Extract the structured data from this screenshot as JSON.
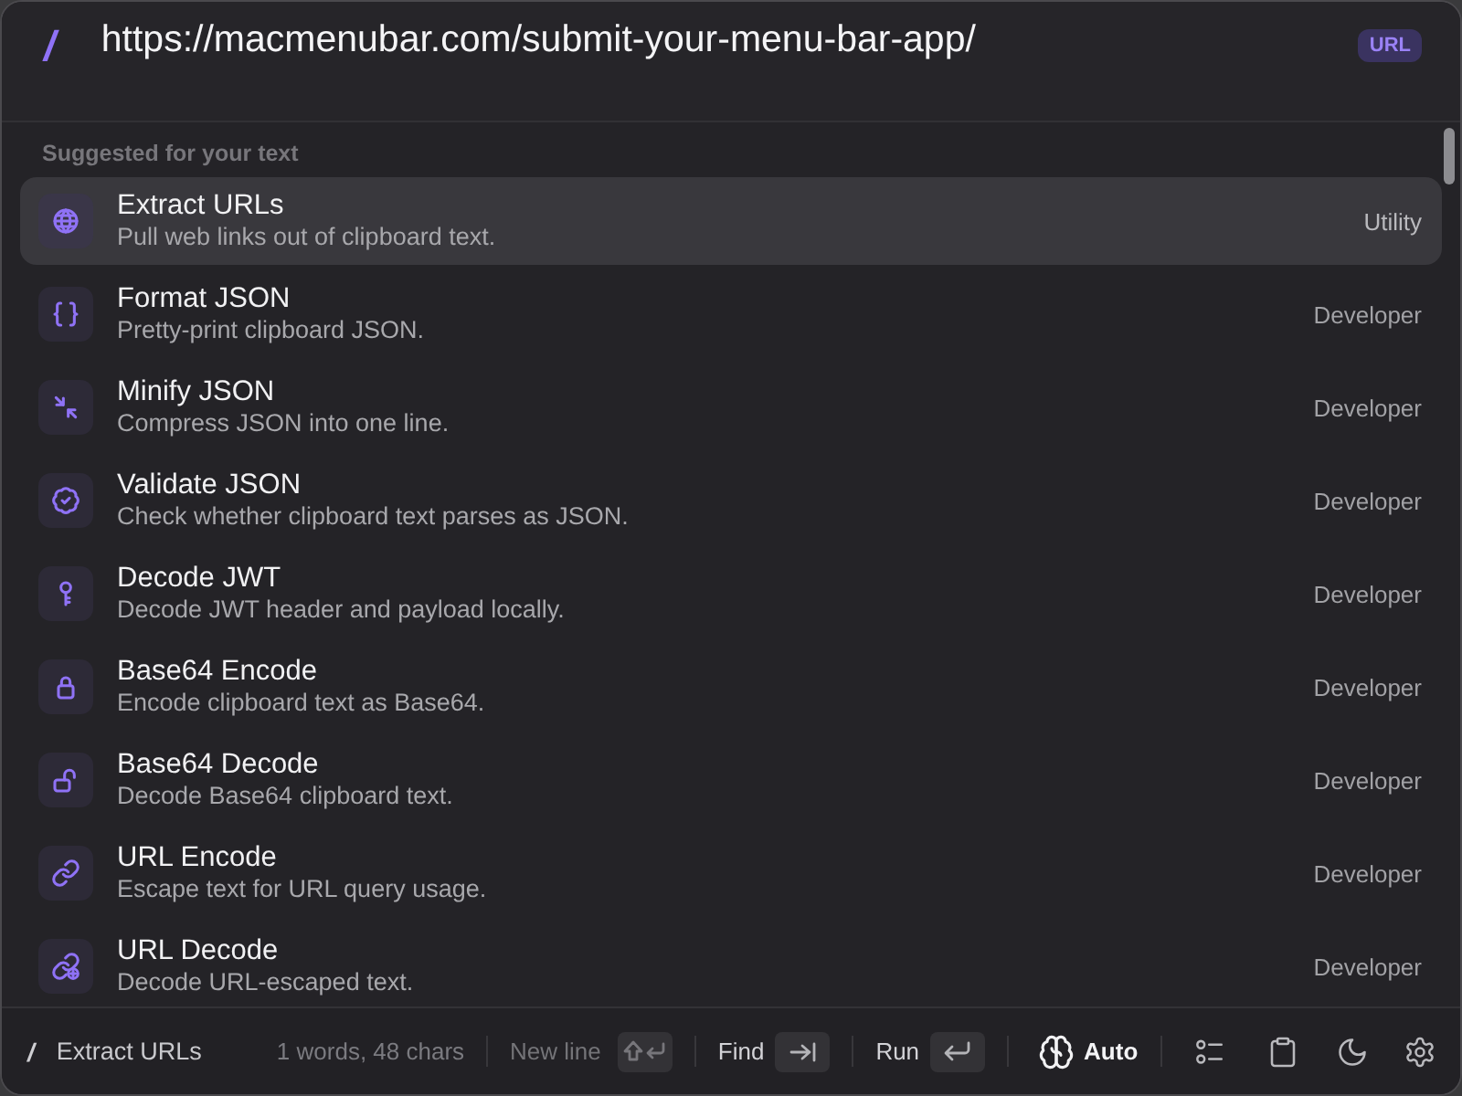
{
  "search": {
    "prompt": "/",
    "value": "https://macmenubar.com/submit-your-menu-bar-app/",
    "badge": "URL"
  },
  "section_title": "Suggested for your text",
  "actions": [
    {
      "title": "Extract URLs",
      "description": "Pull web links out of clipboard text.",
      "category": "Utility",
      "selected": true
    },
    {
      "title": "Format JSON",
      "description": "Pretty-print clipboard JSON.",
      "category": "Developer",
      "selected": false
    },
    {
      "title": "Minify JSON",
      "description": "Compress JSON into one line.",
      "category": "Developer",
      "selected": false
    },
    {
      "title": "Validate JSON",
      "description": "Check whether clipboard text parses as JSON.",
      "category": "Developer",
      "selected": false
    },
    {
      "title": "Decode JWT",
      "description": "Decode JWT header and payload locally.",
      "category": "Developer",
      "selected": false
    },
    {
      "title": "Base64 Encode",
      "description": "Encode clipboard text as Base64.",
      "category": "Developer",
      "selected": false
    },
    {
      "title": "Base64 Decode",
      "description": "Decode Base64 clipboard text.",
      "category": "Developer",
      "selected": false
    },
    {
      "title": "URL Encode",
      "description": "Escape text for URL query usage.",
      "category": "Developer",
      "selected": false
    },
    {
      "title": "URL Decode",
      "description": "Decode URL-escaped text.",
      "category": "Developer",
      "selected": false
    }
  ],
  "footer": {
    "prompt": "/",
    "command": "Extract URLs",
    "stats": "1 words, 48 chars",
    "shortcuts": [
      {
        "label": "New line",
        "kind": "shift-return",
        "disabled": true
      },
      {
        "label": "Find",
        "kind": "tab",
        "disabled": false
      },
      {
        "label": "Run",
        "kind": "return",
        "disabled": false
      }
    ],
    "mode": "Auto"
  }
}
